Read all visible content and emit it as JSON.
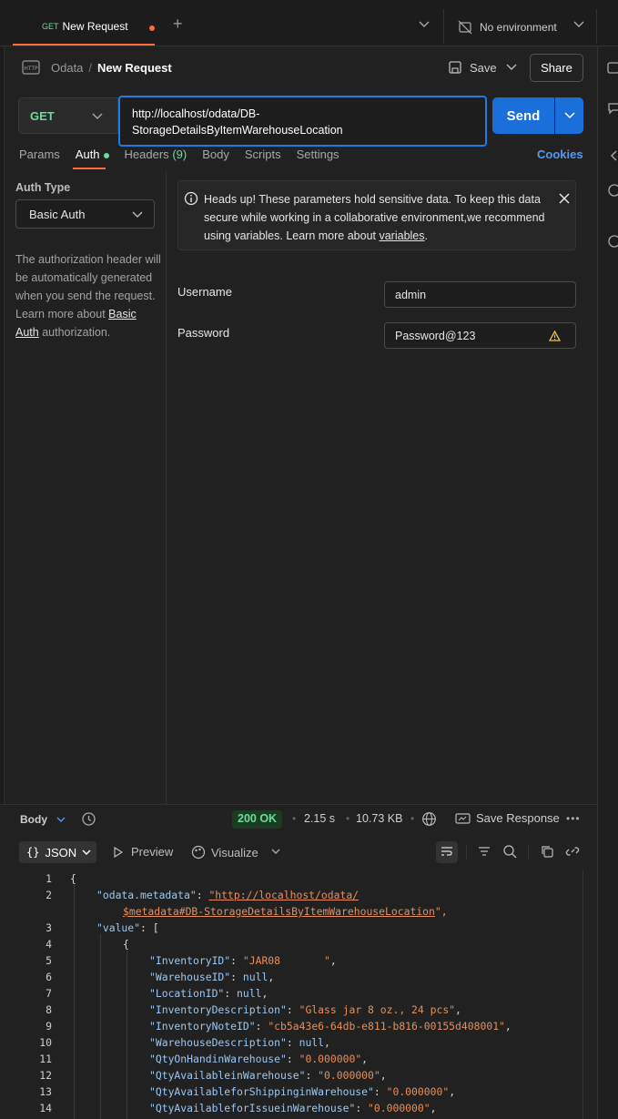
{
  "tab": {
    "method": "GET",
    "title": "New Request"
  },
  "environment": {
    "label": "No environment"
  },
  "breadcrumb": {
    "collection": "Odata",
    "request": "New Request"
  },
  "actions": {
    "save": "Save",
    "share": "Share"
  },
  "request": {
    "method": "GET",
    "url_line1": "http://localhost/odata/DB-",
    "url_line2": "StorageDetailsByItemWarehouseLocation",
    "send": "Send"
  },
  "req_tabs": {
    "params": "Params",
    "auth": "Auth",
    "headers": "Headers",
    "headers_count": "(9)",
    "body": "Body",
    "scripts": "Scripts",
    "settings": "Settings",
    "cookies": "Cookies"
  },
  "auth": {
    "type_label": "Auth Type",
    "type_value": "Basic Auth",
    "desc_before": "The authorization header will be automatically generated when you send the request. Learn more about ",
    "desc_link": "Basic Auth",
    "desc_after": " authorization.",
    "alert_text": "Heads up! These parameters hold sensitive data. To keep this data secure while working in a collaborative environment,we recommend using variables. Learn more about ",
    "alert_link": "variables",
    "alert_end": ".",
    "username_label": "Username",
    "username_value": "admin",
    "password_label": "Password",
    "password_value": "Password@123"
  },
  "response": {
    "body_label": "Body",
    "status": "200 OK",
    "time": "2.15 s",
    "size": "10.73 KB",
    "save_response": "Save Response",
    "format": "JSON",
    "preview": "Preview",
    "visualize": "Visualize"
  },
  "code": {
    "line_numbers": [
      "1",
      "2",
      "",
      "3",
      "4",
      "5",
      "6",
      "7",
      "8",
      "9",
      "10",
      "11",
      "12",
      "13",
      "14"
    ],
    "l1": "{",
    "l2_key": "\"odata.metadata\"",
    "l2_val1": "\"http://localhost/odata/",
    "l2_val2": "$metadata#DB-StorageDetailsByItemWarehouseLocation",
    "l2_end": "\",",
    "l3_key": "\"value\"",
    "l3_rest": ": [",
    "l4": "{",
    "rows": [
      {
        "key": "\"InventoryID\"",
        "val": "\"JAR08       \"",
        "type": "s"
      },
      {
        "key": "\"WarehouseID\"",
        "val": "null",
        "type": "n"
      },
      {
        "key": "\"LocationID\"",
        "val": "null",
        "type": "n"
      },
      {
        "key": "\"InventoryDescription\"",
        "val": "\"Glass jar 8 oz., 24 pcs\"",
        "type": "s"
      },
      {
        "key": "\"InventoryNoteID\"",
        "val": "\"cb5a43e6-64db-e811-b816-00155d408001\"",
        "type": "s"
      },
      {
        "key": "\"WarehouseDescription\"",
        "val": "null",
        "type": "n"
      },
      {
        "key": "\"QtyOnHandinWarehouse\"",
        "val": "\"0.000000\"",
        "type": "s"
      },
      {
        "key": "\"QtyAvailableinWarehouse\"",
        "val": "\"0.000000\"",
        "type": "s"
      },
      {
        "key": "\"QtyAvailableforShippinginWarehouse\"",
        "val": "\"0.000000\"",
        "type": "s"
      },
      {
        "key": "\"QtyAvailableforIssueinWarehouse\"",
        "val": "\"0.000000\"",
        "type": "s"
      }
    ]
  },
  "colors": {
    "accent": "#ff6c37",
    "send": "#1a6fdb",
    "method_get": "#6bdd9a",
    "link": "#4f9cf0"
  }
}
